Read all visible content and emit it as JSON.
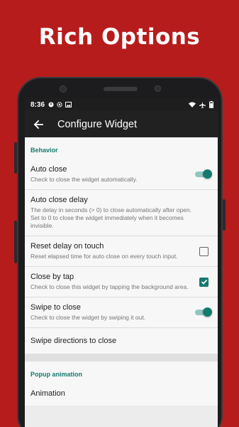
{
  "promo": {
    "headline": "Rich Options"
  },
  "status_bar": {
    "time": "8:36"
  },
  "app_bar": {
    "title": "Configure Widget"
  },
  "sections": [
    {
      "header": "Behavior",
      "items": [
        {
          "title": "Auto close",
          "summary": "Check to close the widget automatically.",
          "control": "switch",
          "checked": true
        },
        {
          "title": "Auto close delay",
          "summary": "The delay in seconds (> 0) to close automatically after open. Set to 0 to close the widget immediately when it becomes invisible.",
          "control": "none"
        },
        {
          "title": "Reset delay on touch",
          "summary": "Reset elapsed time for auto close on every touch input.",
          "control": "checkbox",
          "checked": false
        },
        {
          "title": "Close by tap",
          "summary": "Check to close this widget by tapping the background area.",
          "control": "checkbox",
          "checked": true
        },
        {
          "title": "Swipe to close",
          "summary": "Check to close the widget by swiping it out.",
          "control": "switch",
          "checked": true
        },
        {
          "title": "Swipe directions to close",
          "summary": "",
          "control": "none"
        }
      ]
    },
    {
      "header": "Popup animation",
      "items": [
        {
          "title": "Animation",
          "summary": "",
          "control": "none"
        }
      ]
    }
  ],
  "colors": {
    "accent": "#157a6e",
    "background": "#b71c1c",
    "app_bar": "#212121"
  }
}
